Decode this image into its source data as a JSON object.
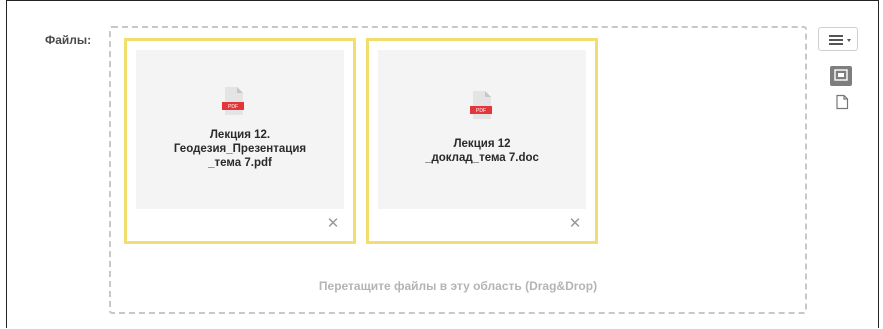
{
  "files_field": {
    "label": "Файлы:",
    "drop_hint": "Перетащите файлы в эту область (Drag&Drop)",
    "files": [
      {
        "name": "Лекция 12.\nГеодезия_Презентация\n_тема 7.pdf",
        "icon": "pdf-file-icon",
        "remove_glyph": "✕"
      },
      {
        "name": "Лекция 12\n_доклад_тема 7.doc",
        "icon": "pdf-file-icon",
        "remove_glyph": "✕"
      }
    ]
  },
  "toolbar": {
    "menu_icon": "menu-dropdown-icon",
    "view_icon": "thumbnail-view-icon",
    "alt_view_icon": "file-list-view-icon"
  },
  "colors": {
    "card_border": "#f1de6e",
    "pdf_badge": "#e2363a",
    "dropzone_border": "#c8c8c8"
  }
}
